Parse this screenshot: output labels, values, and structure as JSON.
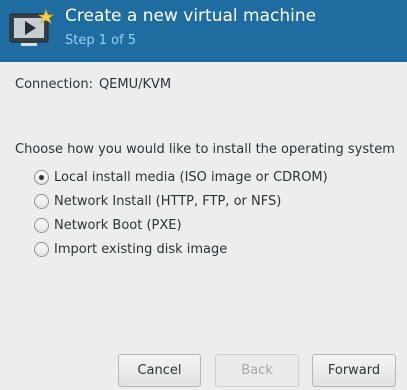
{
  "header": {
    "title": "Create a new virtual machine",
    "subtitle": "Step 1 of 5",
    "icon": "monitor-play-new-icon"
  },
  "connection": {
    "label": "Connection:",
    "value": "QEMU/KVM"
  },
  "install": {
    "prompt": "Choose how you would like to install the operating system",
    "selected": 0,
    "options": [
      "Local install media (ISO image or CDROM)",
      "Network Install (HTTP, FTP, or NFS)",
      "Network Boot (PXE)",
      "Import existing disk image"
    ]
  },
  "buttons": {
    "cancel": "Cancel",
    "back": "Back",
    "forward": "Forward"
  }
}
